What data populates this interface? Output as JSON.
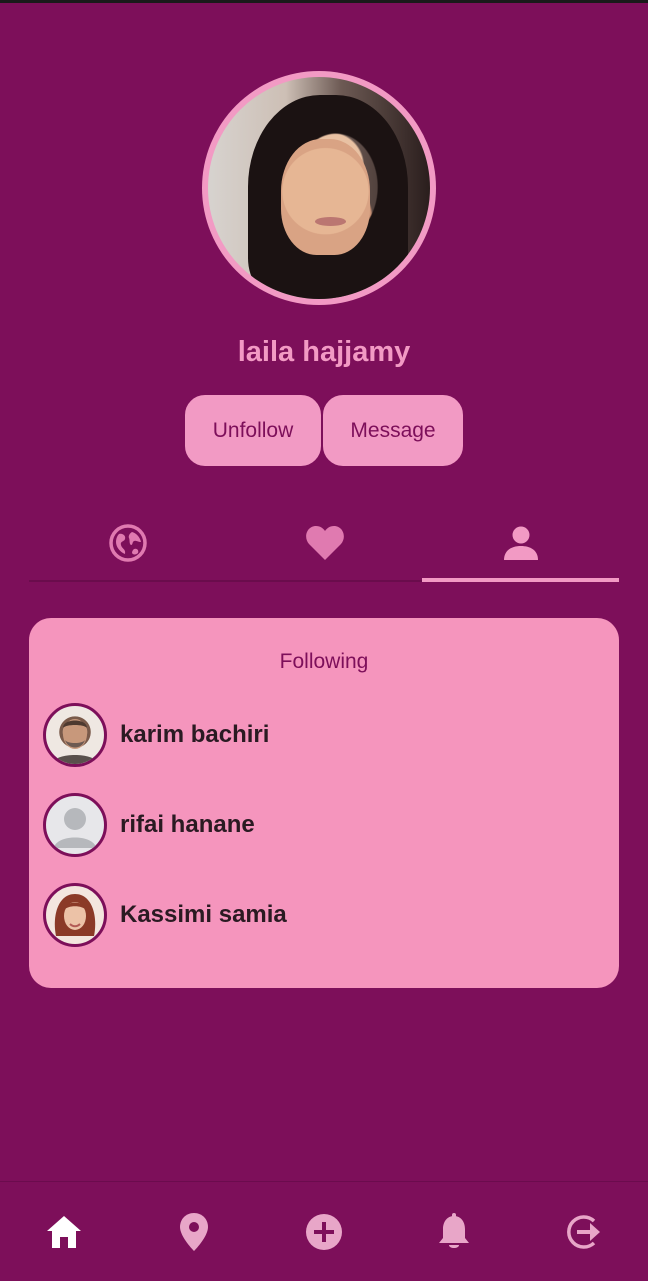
{
  "profile": {
    "name": "laila hajjamy",
    "avatar_icon": "profile-photo"
  },
  "actions": {
    "unfollow_label": "Unfollow",
    "message_label": "Message"
  },
  "tabs": [
    {
      "icon": "globe-icon",
      "active": false
    },
    {
      "icon": "heart-icon",
      "active": false
    },
    {
      "icon": "person-icon",
      "active": true
    }
  ],
  "following": {
    "title": "Following",
    "items": [
      {
        "name": "karim bachiri"
      },
      {
        "name": "rifai hanane"
      },
      {
        "name": "Kassimi samia"
      }
    ]
  },
  "bottom_nav": [
    {
      "icon": "home-icon",
      "active": true
    },
    {
      "icon": "location-pin-icon",
      "active": false
    },
    {
      "icon": "add-circle-icon",
      "active": false
    },
    {
      "icon": "bell-icon",
      "active": false
    },
    {
      "icon": "logout-icon",
      "active": false
    }
  ],
  "colors": {
    "background": "#7d0f5a",
    "accent": "#f29ac4",
    "card": "#f595bd"
  }
}
